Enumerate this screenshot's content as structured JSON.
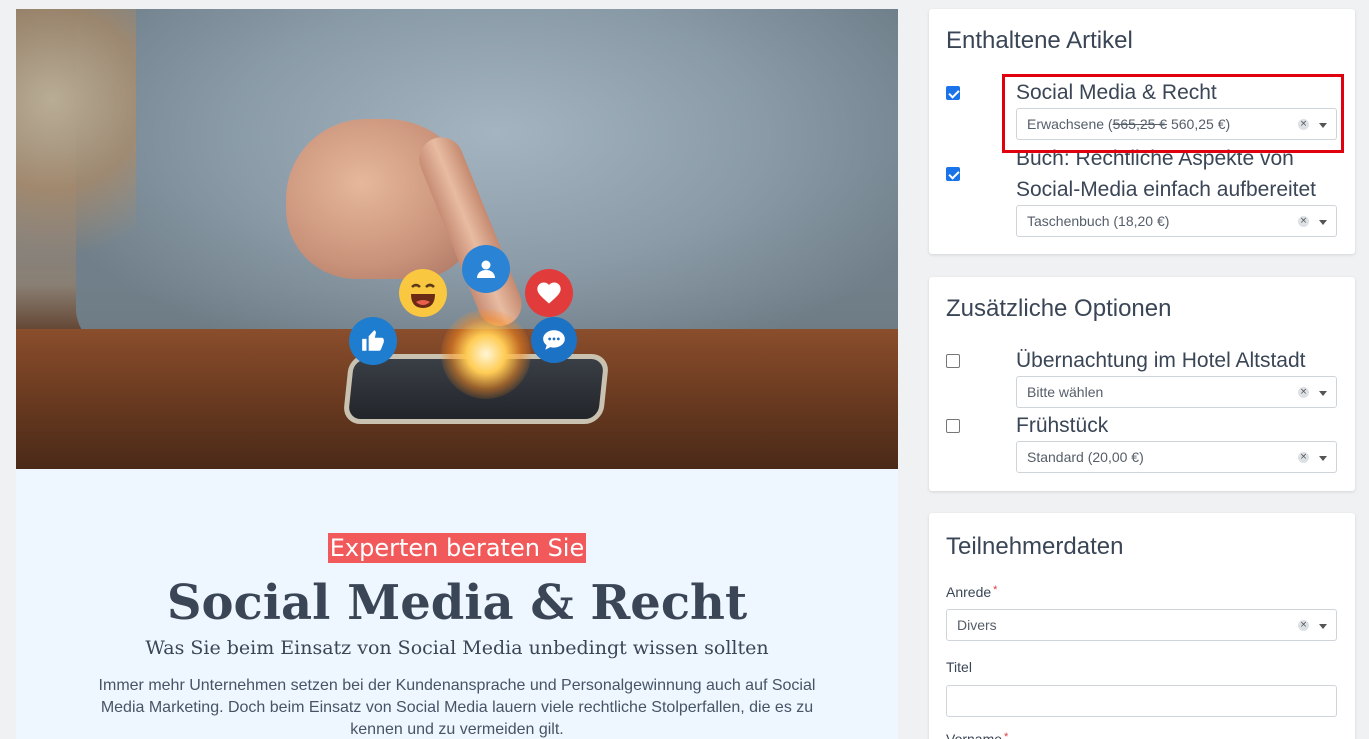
{
  "hero": {
    "tagline": "Experten beraten Sie",
    "title": "Social Media & Recht",
    "subtitle": "Was Sie beim Einsatz von Social Media unbedingt wissen sollten",
    "description": "Immer mehr Unternehmen setzen bei der Kundenansprache und Personalgewinnung auch auf Social Media Marketing. Doch beim Einsatz von Social Media lauern viele rechtliche Stolperfallen, die es zu kennen und zu vermeiden gilt.",
    "icons": [
      "thumbs-up-icon",
      "laughing-emoji-icon",
      "user-icon",
      "heart-icon",
      "chat-bubble-icon"
    ]
  },
  "included": {
    "heading": "Enthaltene Artikel",
    "items": [
      {
        "title": "Social Media & Recht",
        "checked": true,
        "option_prefix": "Erwachsene (",
        "option_old": "565,25 €",
        "option_new": " 560,25 €)"
      },
      {
        "title": "Buch: Rechtliche Aspekte von Social-Media einfach aufbereitet",
        "checked": true,
        "option": "Taschenbuch (18,20 €)"
      }
    ]
  },
  "options": {
    "heading": "Zusätzliche Optionen",
    "items": [
      {
        "title": "Übernachtung im Hotel Altstadt",
        "checked": false,
        "option": "Bitte wählen"
      },
      {
        "title": "Frühstück",
        "checked": false,
        "option": "Standard (20,00 €)"
      }
    ]
  },
  "participant": {
    "heading": "Teilnehmerdaten",
    "salutation_label": "Anrede",
    "salutation_value": "Divers",
    "title_label": "Titel",
    "title_value": "",
    "firstname_label": "Vorname",
    "required_mark": "*"
  },
  "colors": {
    "accent": "#f2595a",
    "checkbox": "#1a73e8",
    "highlight": "#e0000e"
  }
}
